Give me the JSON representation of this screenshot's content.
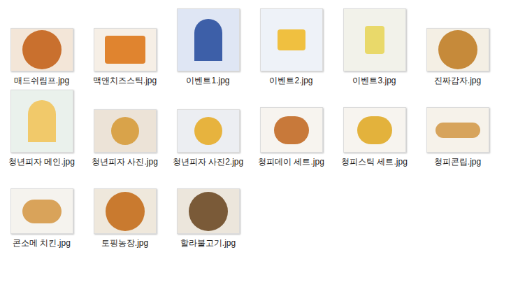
{
  "view": "large-icons",
  "files": [
    {
      "name": "매드쉬림프.jpg"
    },
    {
      "name": "맥앤치즈스틱.jpg"
    },
    {
      "name": "이벤트1.jpg"
    },
    {
      "name": "이벤트2.jpg"
    },
    {
      "name": "이벤트3.jpg"
    },
    {
      "name": "진짜감자.jpg"
    },
    {
      "name": "청년피자 메인.jpg"
    },
    {
      "name": "청년피자 사진.jpg"
    },
    {
      "name": "청년피자 사진2.jpg"
    },
    {
      "name": "청피데이 세트.jpg"
    },
    {
      "name": "청피스틱 세트.jpg"
    },
    {
      "name": "청피콘립.jpg"
    },
    {
      "name": "콘소메 치킨.jpg"
    },
    {
      "name": "토핑농장.jpg"
    },
    {
      "name": "할라불고기.jpg"
    }
  ]
}
